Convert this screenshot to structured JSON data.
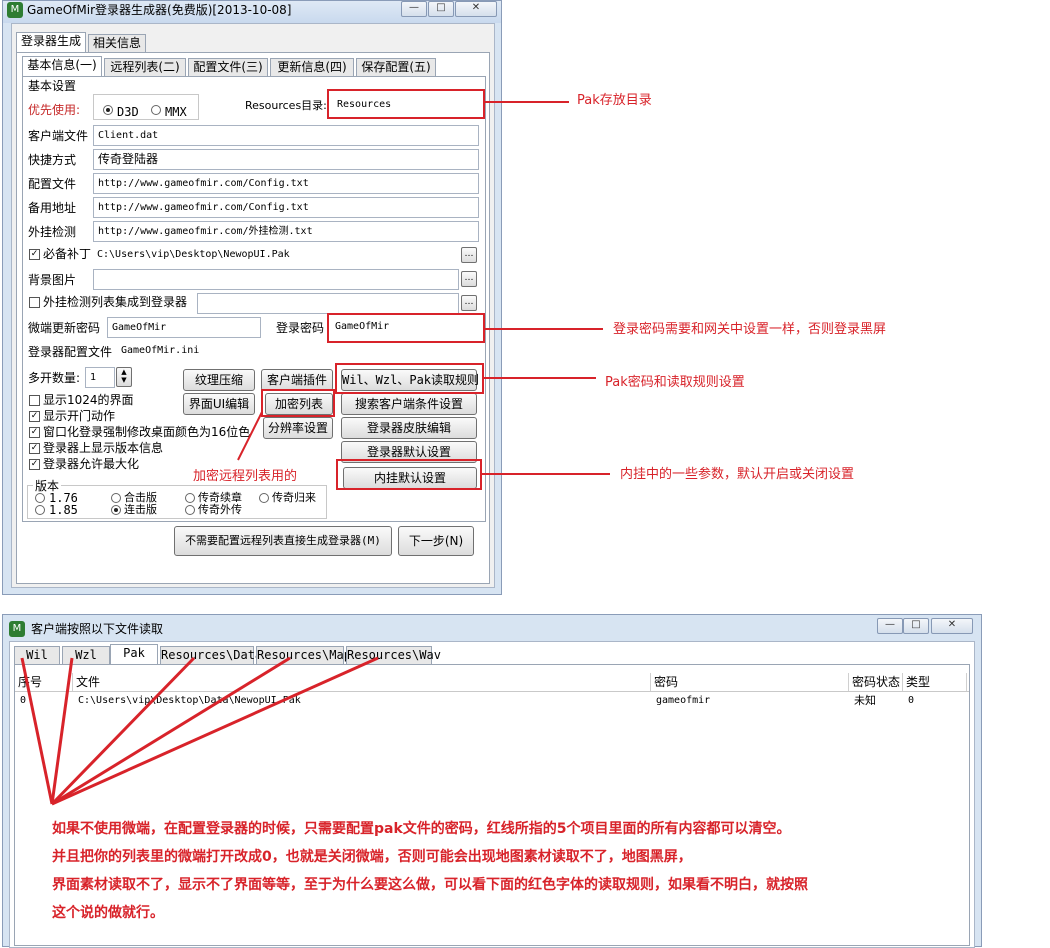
{
  "window1": {
    "title": "GameOfMir登录器生成器(免费版)[2013-10-08]",
    "outer_tabs": [
      "登录器生成",
      "相关信息"
    ],
    "inner_tabs": [
      "基本信息(一)",
      "远程列表(二)",
      "配置文件(三)",
      "更新信息(四)",
      "保存配置(五)"
    ],
    "group_basic": "基本设置",
    "priority_label": "优先使用:",
    "radio_d3d": "D3D",
    "radio_mmx": "MMX",
    "resources_label": "Resources目录:",
    "resources_value": "Resources",
    "rows": [
      {
        "label": "客户端文件",
        "value": "Client.dat"
      },
      {
        "label": "快捷方式",
        "value": "传奇登陆器"
      },
      {
        "label": "配置文件",
        "value": "http://www.gameofmir.com/Config.txt"
      },
      {
        "label": "备用地址",
        "value": "http://www.gameofmir.com/Config.txt"
      },
      {
        "label": "外挂检测",
        "value": "http://www.gameofmir.com/外挂检测.txt"
      }
    ],
    "patch_label": "必备补丁",
    "patch_value": "C:\\Users\\vip\\Desktop\\NewopUI.Pak",
    "bg_label": "背景图片",
    "plugin_list_label": "外挂检测列表集成到登录器",
    "micro_pwd_label": "微端更新密码",
    "micro_pwd_value": "GameOfMir",
    "login_pwd_label": "登录密码",
    "login_pwd_value": "GameOfMir",
    "config_file_label": "登录器配置文件",
    "config_file_value": "GameOfMir.ini",
    "multi_label": "多开数量:",
    "multi_value": "1",
    "checks": [
      "显示1024的界面",
      "显示开门动作",
      "窗口化登录强制修改桌面颜色为16位色",
      "登录器上显示版本信息",
      "登录器允许最大化"
    ],
    "buttons": {
      "texture": "纹理压缩",
      "client_plugin": "客户端插件",
      "read_rules": "Wil、Wzl、Pak读取规则",
      "ui_edit": "界面UI编辑",
      "encrypt_list": "加密列表",
      "search_client": "搜索客户端条件设置",
      "resolution": "分辨率设置",
      "skin_edit": "登录器皮肤编辑",
      "default_settings": "登录器默认设置",
      "plugin_default": "内挂默认设置",
      "direct_generate": "不需要配置远程列表直接生成登录器(M)",
      "next": "下一步(N)"
    },
    "version_group": "版本",
    "versions": [
      "1.76",
      "合击版",
      "传奇续章",
      "传奇归来",
      "1.85",
      "连击版",
      "传奇外传"
    ]
  },
  "annotations": {
    "pak_dir": "Pak存放目录",
    "login_pwd": "登录密码需要和网关中设置一样，否则登录黑屏",
    "pak_pwd_rule": "Pak密码和读取规则设置",
    "plugin_param": "内挂中的一些参数，默认开启或关闭设置",
    "encrypt_remote": "加密远程列表用的"
  },
  "window2": {
    "title": "客户端按照以下文件读取",
    "tabs": [
      "Wil",
      "Wzl",
      "Pak",
      "Resources\\Data",
      "Resources\\Map",
      "Resources\\Wav"
    ],
    "columns": [
      "序号",
      "文件",
      "密码",
      "密码状态",
      "类型"
    ],
    "row": [
      "0",
      "C:\\Users\\vip\\Desktop\\Data\\NewopUI.Pak",
      "gameofmir",
      "未知",
      "0"
    ]
  },
  "notes": [
    "如果不使用微端，在配置登录器的时候，只需要配置pak文件的密码，红线所指的5个项目里面的所有内容都可以清空。",
    "并且把你的列表里的微端打开改成0，也就是关闭微端，否则可能会出现地图素材读取不了，地图黑屏，",
    "界面素材读取不了，显示不了界面等等，至于为什么要这么做，可以看下面的红色字体的读取规则，如果看不明白，就按照",
    "这个说的做就行。"
  ]
}
